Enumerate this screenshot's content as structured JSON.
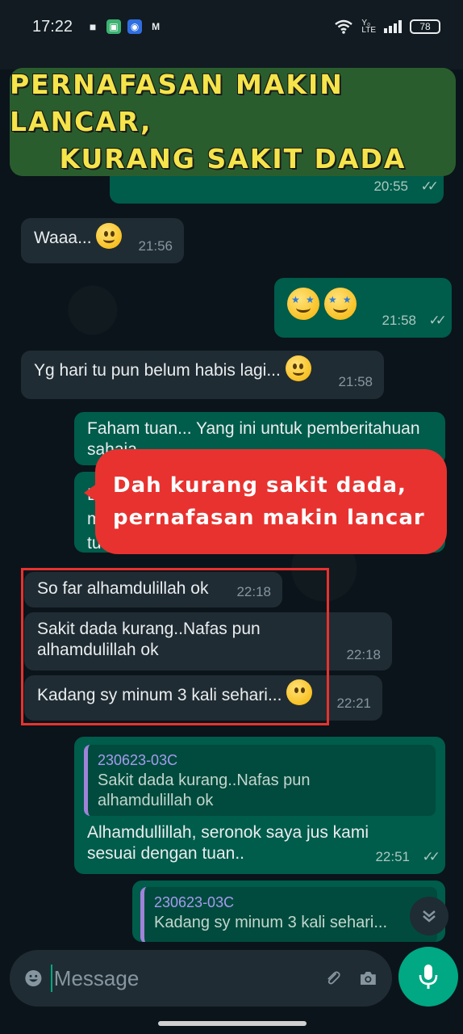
{
  "status_bar": {
    "time": "17:22",
    "battery": "78"
  },
  "banner_top": {
    "line1": "PERNAFASAN MAKIN LANCAR,",
    "line2": "KURANG SAKIT DADA"
  },
  "banner_red": {
    "line1": "Dah kurang sakit dada,",
    "line2": "pernafasan makin lancar"
  },
  "messages": [
    {
      "dir": "out",
      "text": "",
      "time": "20:55"
    },
    {
      "dir": "in",
      "text": "Waaa...",
      "time": "21:56"
    },
    {
      "dir": "out",
      "text": "",
      "time": "21:58"
    },
    {
      "dir": "in",
      "text": "Yg hari tu pun belum habis lagi...",
      "time": "21:58"
    },
    {
      "dir": "out",
      "text": "Faham tuan... Yang ini untuk pemberitahuan sahaja",
      "time": ""
    },
    {
      "dir": "in",
      "text": "So far alhamdulillah ok",
      "time": "22:18"
    },
    {
      "dir": "in",
      "text": "Sakit dada kurang..Nafas pun alhamdulillah ok",
      "time": "22:18"
    },
    {
      "dir": "in",
      "text": "Kadang sy minum 3 kali sehari...",
      "time": "22:21"
    },
    {
      "dir": "out",
      "quote_author": "230623-03C",
      "quote_text": "Sakit dada kurang..Nafas pun alhamdulillah ok",
      "text": "Alhamdullillah, seronok saya jus kami sesuai dengan tuan..",
      "time": "22:51"
    },
    {
      "dir": "out",
      "quote_author": "230623-03C",
      "quote_text": "Kadang sy minum 3 kali sehari...",
      "text": "",
      "time": ""
    }
  ],
  "partial_out_letters": [
    "B",
    "m",
    "tu"
  ],
  "input": {
    "placeholder": "Message"
  },
  "colors": {
    "background": "#0b141a",
    "incoming": "#202c33",
    "outgoing": "#005c4b",
    "accent": "#00a884",
    "banner_green": "#2a5d2e",
    "banner_text": "#f5e44a",
    "banner_red": "#e8322f"
  },
  "icons": [
    "emoji-icon",
    "attach-icon",
    "camera-icon",
    "mic-icon",
    "scroll-down-icon",
    "wifi-icon",
    "signal-icon",
    "battery-icon"
  ]
}
